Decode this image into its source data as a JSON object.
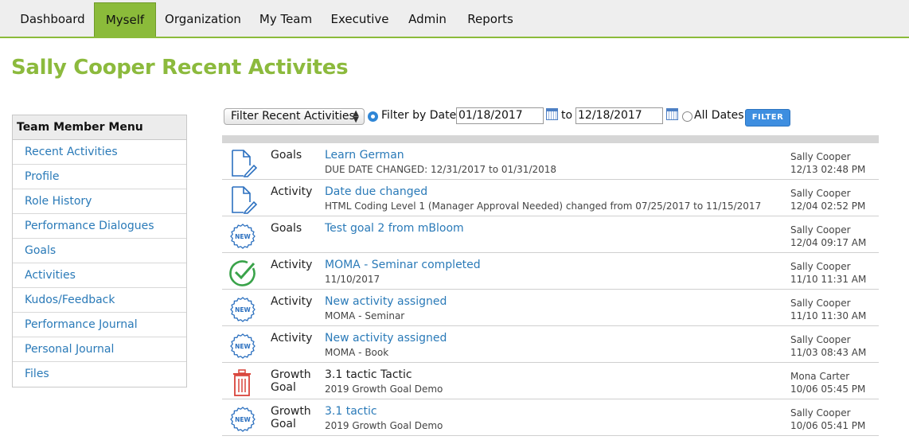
{
  "nav": {
    "tabs": [
      {
        "label": "Dashboard"
      },
      {
        "label": "Myself"
      },
      {
        "label": "Organization"
      },
      {
        "label": "My Team"
      },
      {
        "label": "Executive"
      },
      {
        "label": "Admin"
      },
      {
        "label": "Reports"
      }
    ],
    "active": "Myself"
  },
  "page": {
    "title": "Sally Cooper Recent Activites"
  },
  "sidebar": {
    "heading": "Team Member Menu",
    "items": [
      {
        "label": "Recent Activities"
      },
      {
        "label": "Profile"
      },
      {
        "label": "Role History"
      },
      {
        "label": "Performance Dialogues"
      },
      {
        "label": "Goals"
      },
      {
        "label": "Activities"
      },
      {
        "label": "Kudos/Feedback"
      },
      {
        "label": "Performance Journal"
      },
      {
        "label": "Personal Journal"
      },
      {
        "label": "Files"
      }
    ]
  },
  "filter": {
    "select_value": "Filter Recent Activities",
    "by_date_label": "Filter by Date:",
    "from_date": "01/18/2017",
    "to_label": "to",
    "to_date": "12/18/2017",
    "all_dates_label": "All Dates",
    "mode": "by_date",
    "button_label": "FILTER"
  },
  "activities": [
    {
      "icon": "document-edit-icon",
      "type": "Goals",
      "title": "Learn German",
      "title_link": true,
      "sub": "DUE DATE CHANGED: 12/31/2017 to 01/31/2018",
      "who": "Sally Cooper",
      "when": "12/13 02:48 PM"
    },
    {
      "icon": "document-edit-icon",
      "type": "Activity",
      "title": "Date due changed",
      "title_link": true,
      "sub": "HTML Coding Level 1 (Manager Approval Needed) changed from 07/25/2017 to 11/15/2017",
      "who": "Sally Cooper",
      "when": "12/04 02:52 PM"
    },
    {
      "icon": "new-badge-icon",
      "type": "Goals",
      "title": "Test goal 2 from mBloom",
      "title_link": true,
      "sub": "",
      "who": "Sally Cooper",
      "when": "12/04 09:17 AM"
    },
    {
      "icon": "check-circle-icon",
      "type": "Activity",
      "title": "MOMA - Seminar completed",
      "title_link": true,
      "sub": "11/10/2017",
      "who": "Sally Cooper",
      "when": "11/10 11:31 AM"
    },
    {
      "icon": "new-badge-icon",
      "type": "Activity",
      "title": "New activity assigned",
      "title_link": true,
      "sub": "MOMA - Seminar",
      "who": "Sally Cooper",
      "when": "11/10 11:30 AM"
    },
    {
      "icon": "new-badge-icon",
      "type": "Activity",
      "title": "New activity assigned",
      "title_link": true,
      "sub": "MOMA - Book",
      "who": "Sally Cooper",
      "when": "11/03 08:43 AM"
    },
    {
      "icon": "trash-icon",
      "type": "Growth Goal",
      "title": "3.1 tactic Tactic",
      "title_link": false,
      "sub": "2019 Growth Goal Demo",
      "who": "Mona Carter",
      "when": "10/06 05:45 PM"
    },
    {
      "icon": "new-badge-icon",
      "type": "Growth Goal",
      "title": "3.1 tactic",
      "title_link": true,
      "sub": "2019 Growth Goal Demo",
      "who": "Sally Cooper",
      "when": "10/06 05:41 PM"
    }
  ],
  "colors": {
    "brand_green": "#8cba3d",
    "link_blue": "#2a7ab8",
    "button_blue": "#3e8ee0",
    "check_green": "#3aa34a",
    "trash_red": "#d9443a",
    "icon_blue": "#2a6fbf"
  }
}
